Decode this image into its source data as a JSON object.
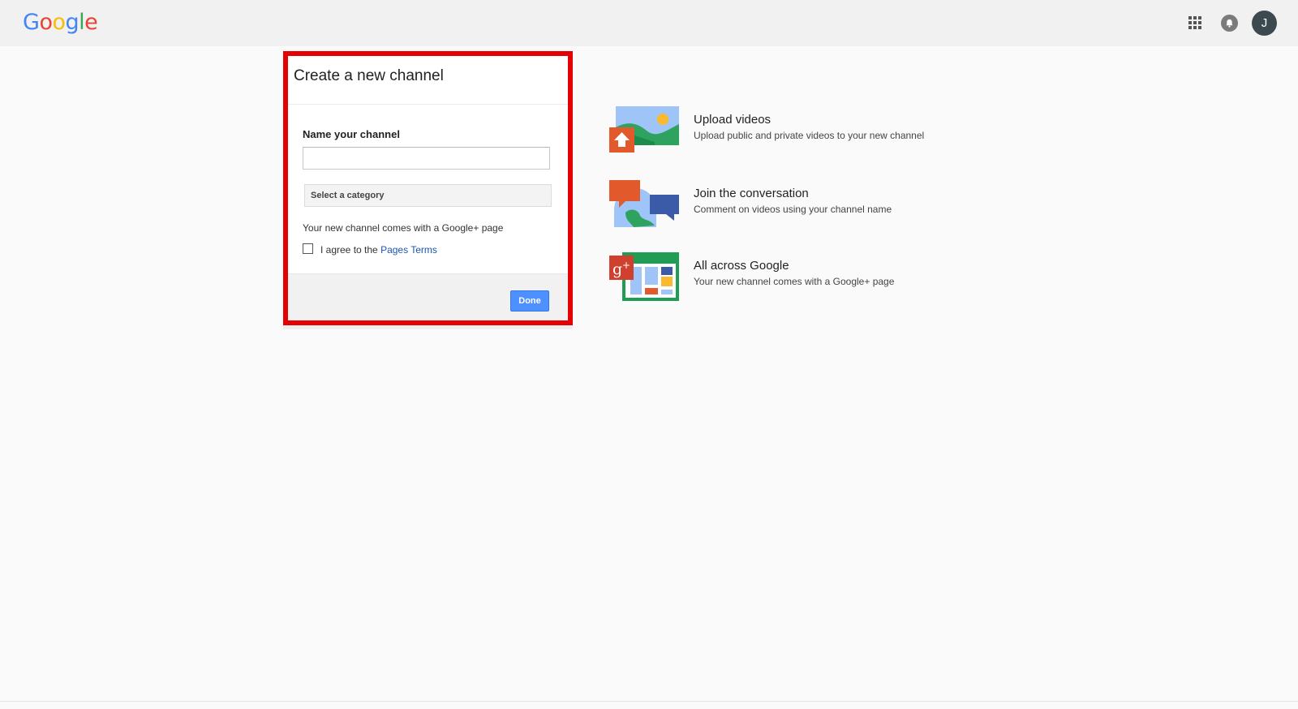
{
  "header": {
    "logo_letters": [
      {
        "char": "G",
        "color": "#4285F4"
      },
      {
        "char": "o",
        "color": "#EA4335"
      },
      {
        "char": "o",
        "color": "#FBBC05"
      },
      {
        "char": "g",
        "color": "#4285F4"
      },
      {
        "char": "l",
        "color": "#34A853"
      },
      {
        "char": "e",
        "color": "#EA4335"
      }
    ],
    "apps_icon": "apps-grid-icon",
    "notifications_icon": "bell-icon",
    "avatar_initial": "J"
  },
  "dialog": {
    "title": "Create a new channel",
    "name_label": "Name your channel",
    "name_value": "",
    "category_selected": "Select a category",
    "gplus_note": "Your new channel comes with a Google+ page",
    "agree_prefix": "I agree to the",
    "agree_link": "Pages Terms",
    "agree_checked": false,
    "done_label": "Done",
    "highlight_color": "#e50003",
    "button_color": "#4d90fe"
  },
  "features": [
    {
      "icon": "upload-photo-icon",
      "title": "Upload videos",
      "description": "Upload public and private videos to your new channel"
    },
    {
      "icon": "conversation-bubbles-icon",
      "title": "Join the conversation",
      "description": "Comment on videos using your channel name"
    },
    {
      "icon": "google-plus-page-icon",
      "title": "All across Google",
      "description": "Your new channel comes with a Google+ page"
    }
  ]
}
